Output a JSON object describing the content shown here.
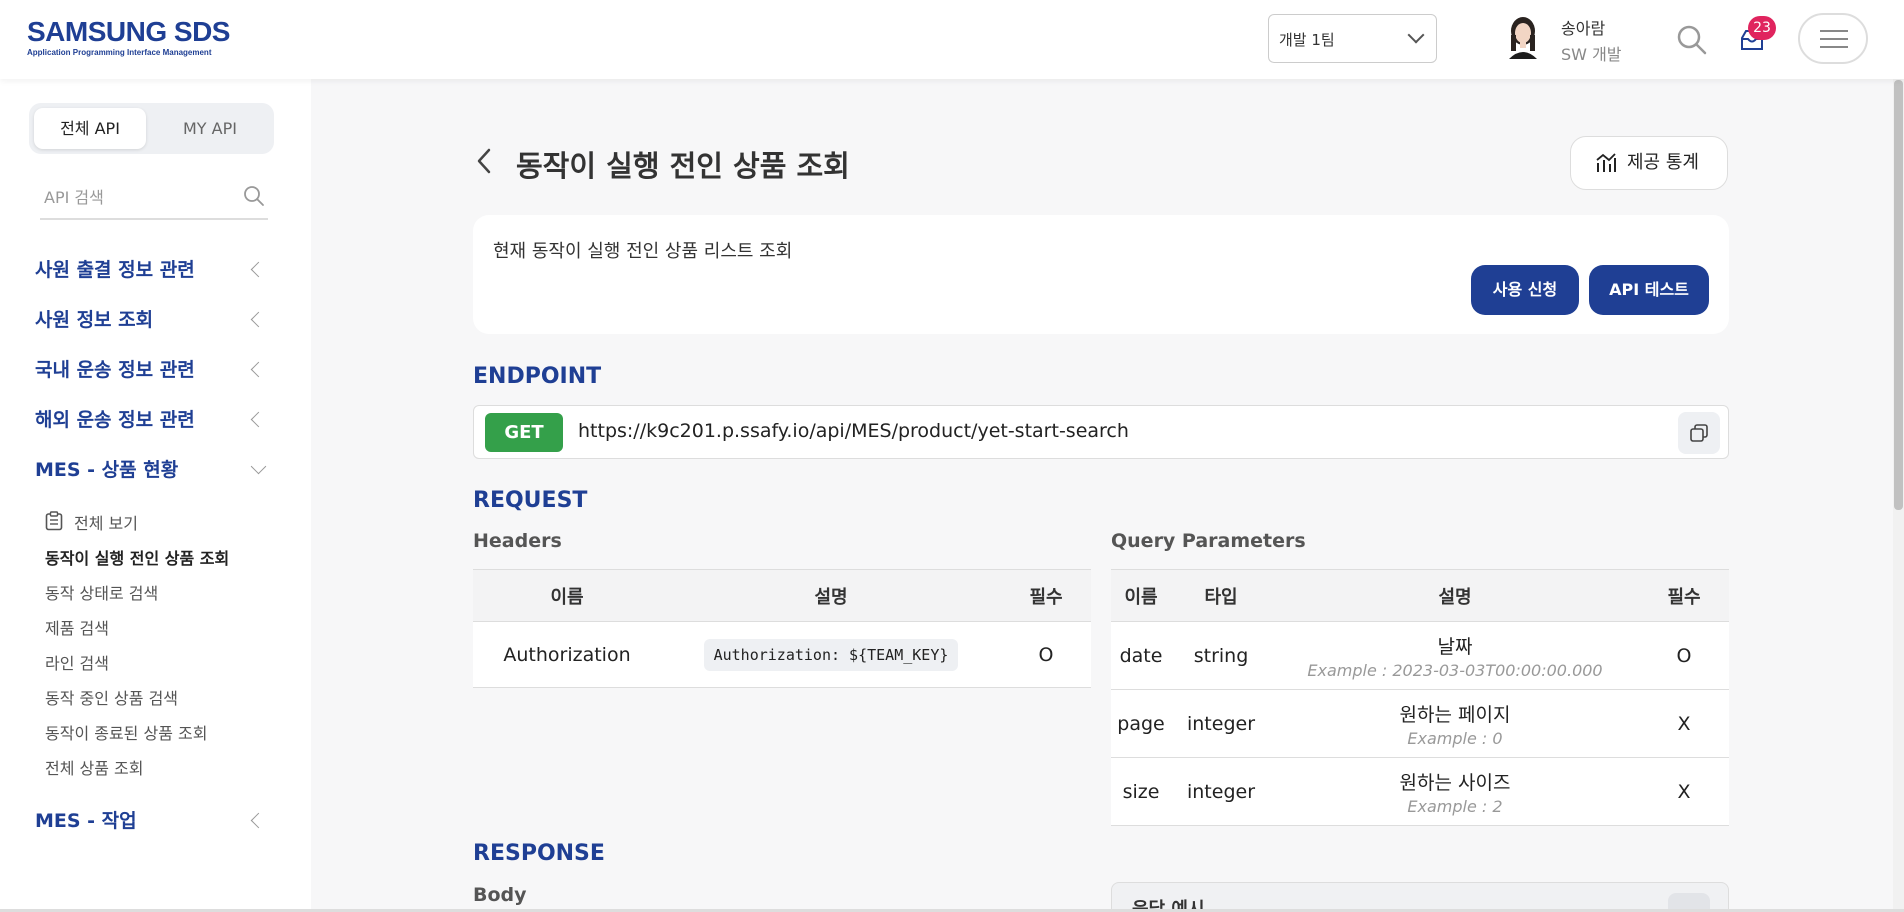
{
  "header": {
    "logo_main": "SAMSUNG SDS",
    "logo_sub": "Application Programming Interface Management",
    "team_select": "개발 1팀",
    "user_name": "송아람",
    "user_dept": "SW 개발",
    "notification_count": "23",
    "brand_color": "#1f3f94",
    "badge_color": "#e0245e"
  },
  "sidebar": {
    "tabs": [
      "전체 API",
      "MY API"
    ],
    "active_tab": "전체 API",
    "search_placeholder": "API 검색",
    "groups": [
      {
        "label": "사원 출결 정보 관련",
        "expanded": false
      },
      {
        "label": "사원 정보 조회",
        "expanded": false
      },
      {
        "label": "국내 운송 정보 관련",
        "expanded": false
      },
      {
        "label": "해외 운송 정보 관련",
        "expanded": false
      },
      {
        "label": "MES - 상품 현황",
        "expanded": true
      },
      {
        "label": "MES - 작업",
        "expanded": false
      }
    ],
    "sub_items": [
      "전체 보기",
      "동작이 실행 전인 상품 조회",
      "동작 상태로 검색",
      "제품 검색",
      "라인 검색",
      "동작 중인 상품 검색",
      "동작이 종료된 상품 조회",
      "전체 상품 조회"
    ],
    "active_sub_item": "동작이 실행 전인 상품 조회"
  },
  "main": {
    "title": "동작이 실행 전인 상품 조회",
    "stats_button": "제공 통계",
    "description": "현재 동작이 실행 전인 상품 리스트 조회",
    "apply_button": "사용 신청",
    "test_button": "API 테스트",
    "endpoint_title": "ENDPOINT",
    "method": "GET",
    "method_color": "#34a04a",
    "url": "https://k9c201.p.ssafy.io/api/MES/product/yet-start-search",
    "request_title": "REQUEST",
    "headers_title": "Headers",
    "headers_table": {
      "columns": [
        "이름",
        "설명",
        "필수"
      ],
      "rows": [
        [
          "Authorization",
          "Authorization: ${TEAM_KEY}",
          "O"
        ]
      ]
    },
    "query_title": "Query Parameters",
    "query_table": {
      "columns": [
        "이름",
        "타입",
        "설명",
        "필수"
      ],
      "rows": [
        {
          "name": "date",
          "type": "string",
          "desc": "날짜",
          "example": "Example : 2023-03-03T00:00:00.000",
          "required": "O"
        },
        {
          "name": "page",
          "type": "integer",
          "desc": "원하는 페이지",
          "example": "Example : 0",
          "required": "X"
        },
        {
          "name": "size",
          "type": "integer",
          "desc": "원하는 사이즈",
          "example": "Example : 2",
          "required": "X"
        }
      ]
    },
    "response_title": "RESPONSE",
    "body_title": "Body",
    "response_example_label": "응답 예시"
  }
}
